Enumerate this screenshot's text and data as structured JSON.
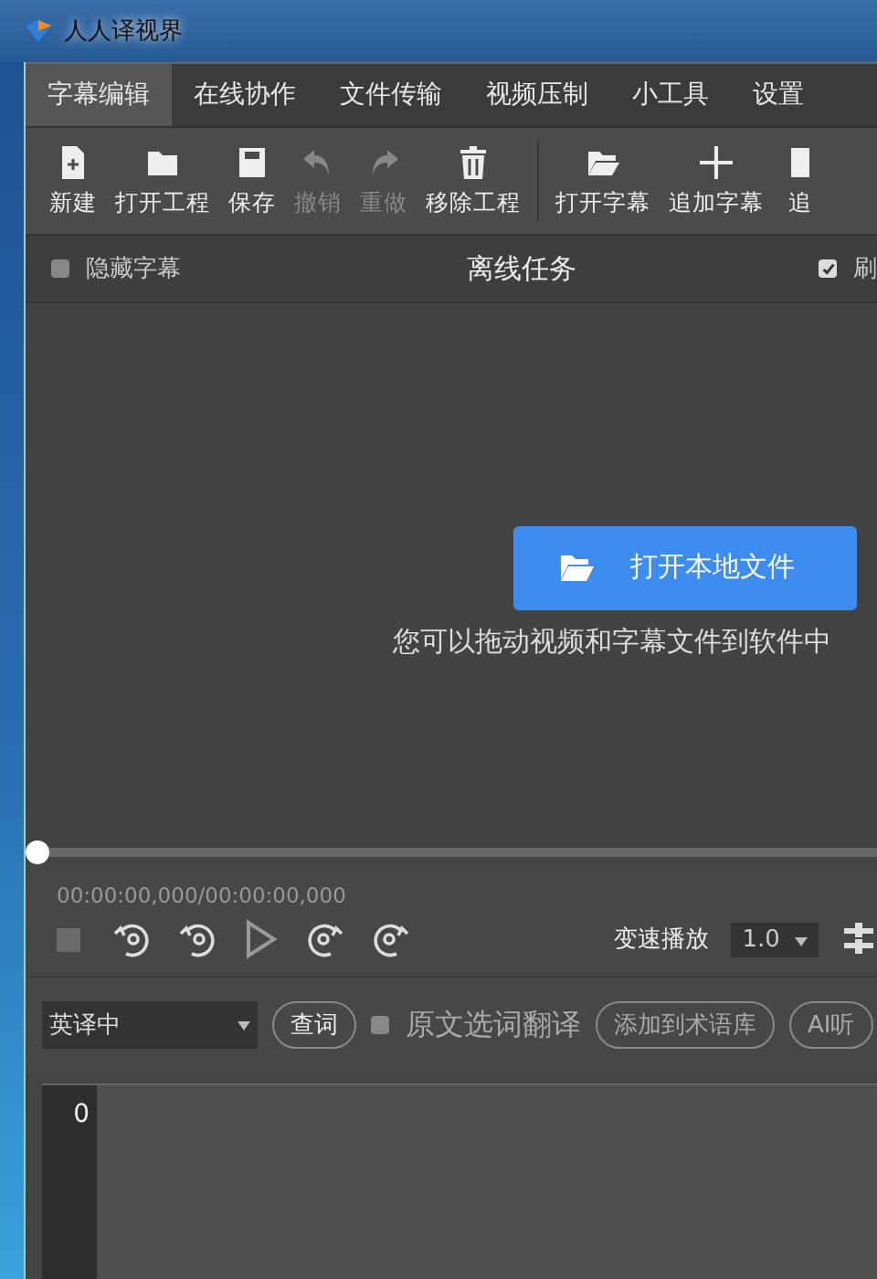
{
  "window": {
    "title": "人人译视界"
  },
  "menu_tabs": [
    {
      "label": "字幕编辑",
      "selected": true
    },
    {
      "label": "在线协作",
      "selected": false
    },
    {
      "label": "文件传输",
      "selected": false
    },
    {
      "label": "视频压制",
      "selected": false
    },
    {
      "label": "小工具",
      "selected": false
    },
    {
      "label": "设置",
      "selected": false
    }
  ],
  "toolbar": [
    [
      {
        "label": "新建",
        "disabled": false
      },
      {
        "label": "打开工程",
        "disabled": false
      },
      {
        "label": "保存",
        "disabled": false
      },
      {
        "label": "撤销",
        "disabled": true
      },
      {
        "label": "重做",
        "disabled": true
      },
      {
        "label": "移除工程",
        "disabled": false
      }
    ],
    [
      {
        "label": "打开字幕",
        "disabled": false
      },
      {
        "label": "追加字幕",
        "disabled": false
      },
      {
        "label": "追",
        "disabled": false
      }
    ]
  ],
  "options_bar": {
    "hide_subtitles": {
      "label": "隐藏字幕",
      "checked": false
    },
    "title": "离线任务",
    "refresh": {
      "label": "刷",
      "checked": true
    }
  },
  "drop_area": {
    "button": "打开本地文件",
    "hint": "您可以拖动视频和字幕文件到软件中"
  },
  "player": {
    "timeline": {
      "level": 0
    },
    "time": "00:00:00,000/00:00:00,000",
    "speed_label": "变速播放",
    "speed": "1.0"
  },
  "translate_bar": {
    "language": "英译中",
    "lookup": "查词",
    "select_translate": {
      "label": "原文选词翻译",
      "checked": false
    },
    "buttons": [
      "添加到术语库",
      "AI听"
    ]
  },
  "editor": {
    "line_numbers": [
      "0"
    ]
  }
}
